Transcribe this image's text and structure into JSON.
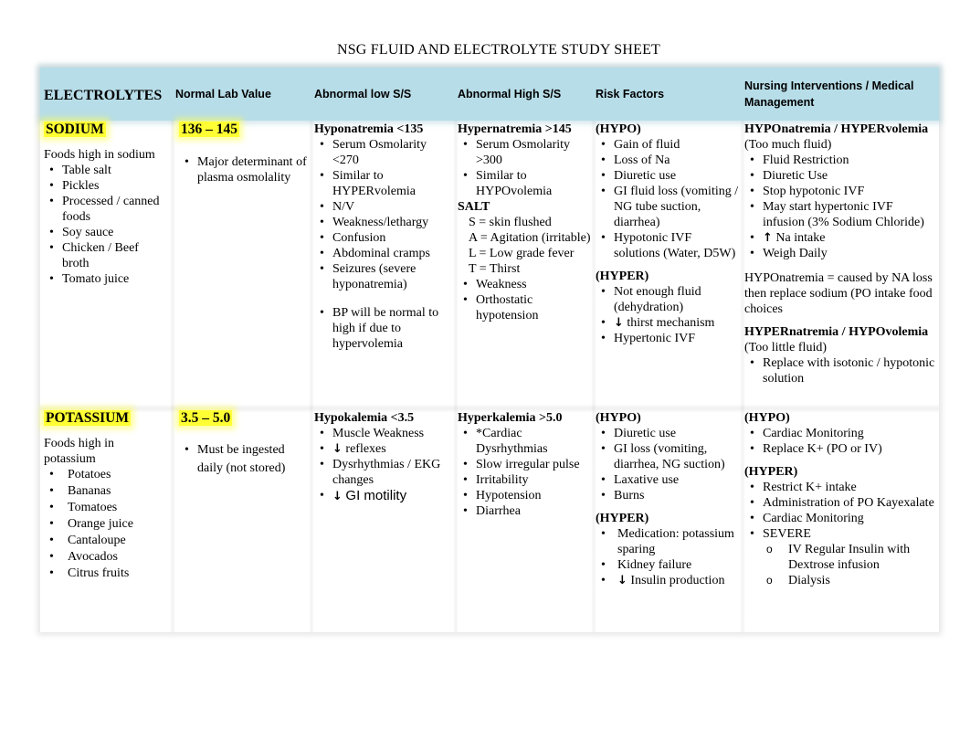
{
  "document": {
    "title": "NSG FLUID AND ELECTROLYTE STUDY SHEET"
  },
  "headers": {
    "electrolytes": "ELECTROLYTES",
    "normal_lab": "Normal Lab Value",
    "abnormal_low": "Abnormal low S/S",
    "abnormal_high": "Abnormal High S/S",
    "risk_factors": "Risk Factors",
    "interventions": "Nursing Interventions / Medical Management"
  },
  "sodium": {
    "name": "SODIUM",
    "foods_title": "Foods high in sodium",
    "foods": [
      "Table salt",
      "Pickles",
      "Processed / canned foods",
      "Soy sauce",
      "Chicken / Beef broth",
      "Tomato juice"
    ],
    "normal_value": "136 – 145",
    "normal_notes": [
      "Major determinant of plasma osmolality"
    ],
    "low_title": "Hyponatremia <135",
    "low_items": [
      "Serum Osmolarity <270",
      "Similar to HYPERvolemia",
      "N/V",
      "Weakness/lethargy",
      "Confusion",
      "Abdominal cramps",
      "Seizures (severe hyponatremia)"
    ],
    "low_note": "BP will be normal to high if due to hypervolemia",
    "high_title": "Hypernatremia >145",
    "high_items": [
      "Serum Osmolarity >300",
      "Similar to HYPOvolemia"
    ],
    "salt_title": "SALT",
    "salt_lines": [
      "S = skin flushed",
      "A = Agitation (irritable)",
      "L = Low grade fever",
      "T = Thirst"
    ],
    "high_items_2": [
      "Weakness",
      "Orthostatic hypotension"
    ],
    "risk_hypo_title": "(HYPO)",
    "risk_hypo": [
      "Gain of fluid",
      "Loss of Na",
      "Diuretic use",
      "GI fluid loss (vomiting / NG tube suction, diarrhea)",
      "Hypotonic IVF solutions (Water, D5W)"
    ],
    "risk_hyper_title": "(HYPER)",
    "risk_hyper": [
      "Not enough fluid (dehydration)"
    ],
    "risk_hyper_arrow_item": "thirst mechanism",
    "risk_hyper_last": "Hypertonic IVF",
    "int_hypo_title_1": "HYPOnatremia / HYPERvolemia",
    "int_hypo_title_2": "(Too much fluid)",
    "int_hypo": [
      "Fluid Restriction",
      "Diuretic Use",
      "Stop hypotonic IVF",
      "May start hypertonic IVF infusion (3% Sodium Chloride)"
    ],
    "int_hypo_arrow_item": "Na intake",
    "int_hypo_last": "Weigh Daily",
    "int_note": "HYPOnatremia = caused by NA loss then replace sodium (PO intake food choices",
    "int_hyper_title_1": "HYPERnatremia / HYPOvolemia",
    "int_hyper_title_2": "(Too little fluid)",
    "int_hyper": [
      "Replace with isotonic / hypotonic solution"
    ]
  },
  "potassium": {
    "name": "POTASSIUM",
    "foods_title": "Foods high in potassium",
    "foods": [
      "Potatoes",
      "Bananas",
      "Tomatoes",
      "Orange juice",
      "Cantaloupe",
      "Avocados",
      "Citrus fruits"
    ],
    "normal_value": "3.5 – 5.0",
    "normal_notes": [
      "Must be ingested daily (not stored)"
    ],
    "low_title": "Hypokalemia <3.5",
    "low_item_1": "Muscle Weakness",
    "low_arrow_item": "reflexes",
    "low_item_3": "Dysrhythmias / EKG changes",
    "low_arrow_item_2": "GI motility",
    "high_title": "Hyperkalemia >5.0",
    "high_items": [
      "*Cardiac Dysrhythmias",
      "Slow irregular pulse",
      "Irritability",
      "Hypotension",
      "Diarrhea"
    ],
    "risk_hypo_title": "(HYPO)",
    "risk_hypo": [
      "Diuretic use",
      "GI loss (vomiting, diarrhea, NG suction)",
      "Laxative use",
      "Burns"
    ],
    "risk_hyper_title": "(HYPER)",
    "risk_hyper": [
      "Medication: potassium sparing",
      "Kidney failure"
    ],
    "risk_hyper_arrow_item": "Insulin production",
    "int_hypo_title": "(HYPO)",
    "int_hypo": [
      "Cardiac Monitoring",
      "Replace K+ (PO or IV)"
    ],
    "int_hyper_title": "(HYPER)",
    "int_hyper": [
      "Restrict K+ intake",
      "Administration of PO Kayexalate",
      "Cardiac Monitoring",
      "SEVERE"
    ],
    "int_severe": [
      "IV Regular Insulin with Dextrose infusion",
      "Dialysis"
    ]
  },
  "icons": {
    "arrow_up": "↑",
    "arrow_down": "↓"
  }
}
